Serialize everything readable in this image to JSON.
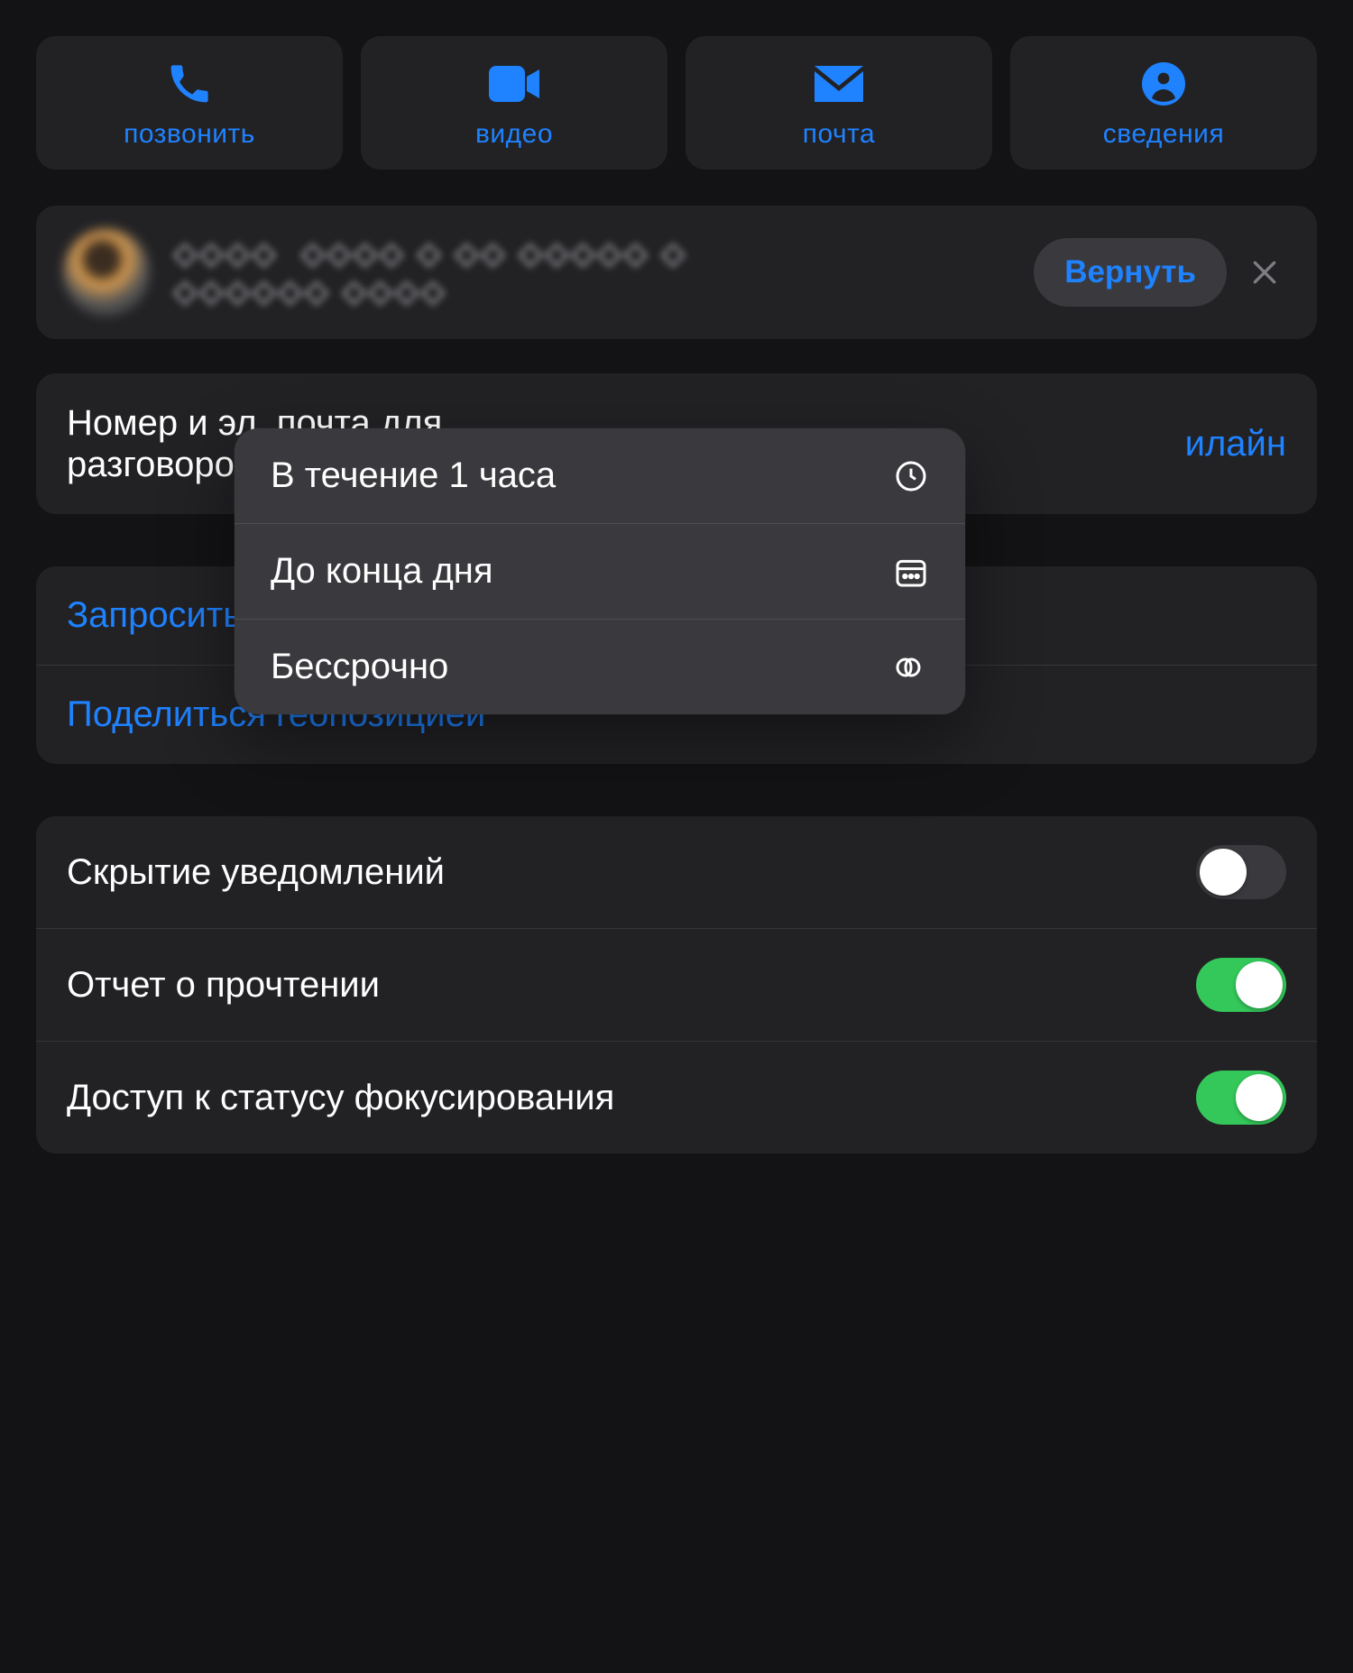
{
  "actions": {
    "call": {
      "label": "позвонить"
    },
    "video": {
      "label": "видео"
    },
    "mail": {
      "label": "почта"
    },
    "info": {
      "label": "сведения"
    }
  },
  "suggestion": {
    "blurred_text": "◇◇◇◇  ◇◇◇◇ ◇ ◇◇ ◇◇◇◇◇ ◇\n◇◇◇◇◇◇ ◇◇◇◇",
    "action_label": "Вернуть"
  },
  "conversation_row": {
    "line1": "Номер и эл. почта для",
    "line2": "разговоров",
    "value_partial": "илайн"
  },
  "links": {
    "request": "Запросить текущую геопозицию",
    "share": "Поделиться геопозицией"
  },
  "toggles": {
    "hide_alerts": {
      "label": "Скрытие уведомлений",
      "on": false
    },
    "read_receipts": {
      "label": "Отчет о прочтении",
      "on": true
    },
    "focus_status": {
      "label": "Доступ к статусу фокусирования",
      "on": true
    }
  },
  "popup": {
    "opt1": "В течение 1 часа",
    "opt2": "До конца дня",
    "opt3": "Бессрочно"
  }
}
